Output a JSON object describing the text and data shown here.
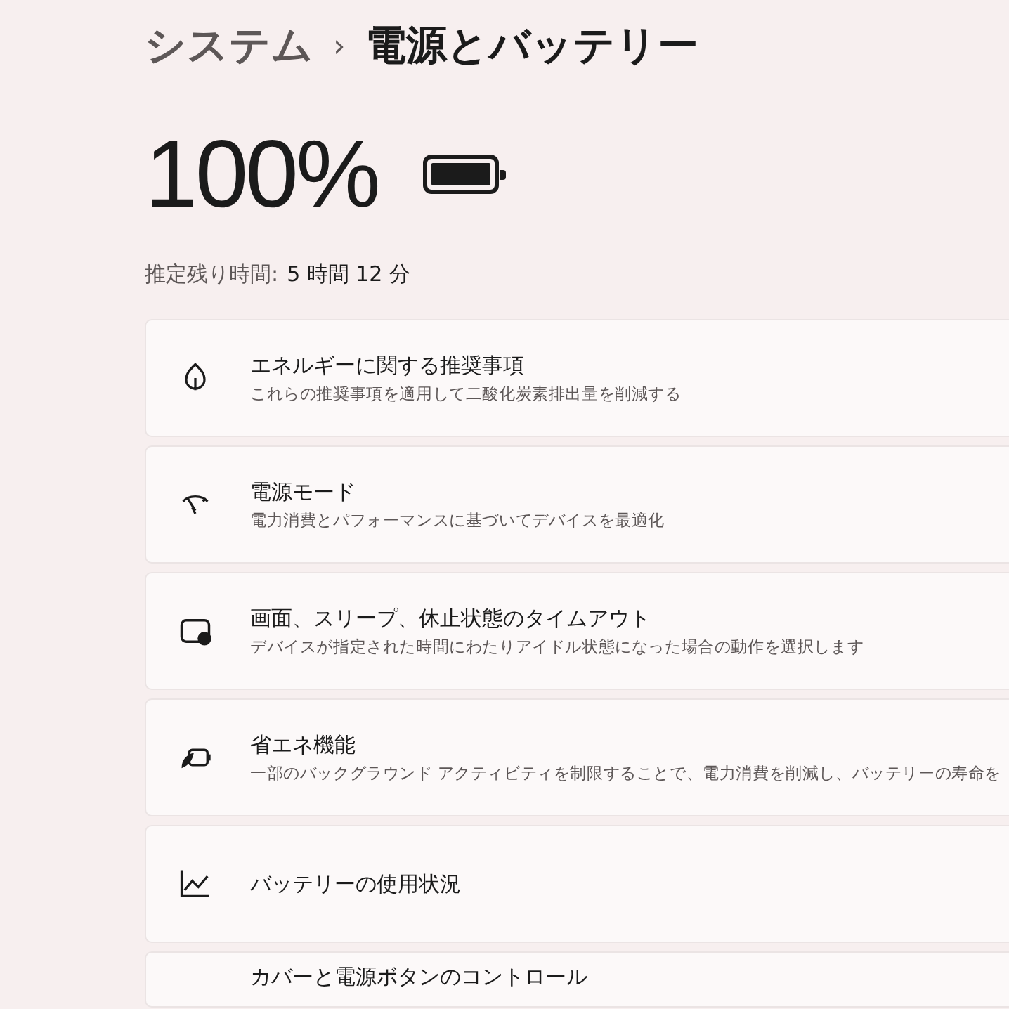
{
  "breadcrumb": {
    "parent": "システム",
    "separator": "›",
    "current": "電源とバッテリー"
  },
  "battery": {
    "percent": "100%",
    "level": 1.0,
    "remaining_label": "推定残り時間:",
    "remaining_value": "5 時間 12 分"
  },
  "settings": [
    {
      "title": "エネルギーに関する推奨事項",
      "description": "これらの推奨事項を適用して二酸化炭素排出量を削減する"
    },
    {
      "title": "電源モード",
      "description": "電力消費とパフォーマンスに基づいてデバイスを最適化"
    },
    {
      "title": "画面、スリープ、休止状態のタイムアウト",
      "description": "デバイスが指定された時間にわたりアイドル状態になった場合の動作を選択します"
    },
    {
      "title": "省エネ機能",
      "description": "一部のバックグラウンド アクティビティを制限することで、電力消費を削減し、バッテリーの寿命を"
    },
    {
      "title": "バッテリーの使用状況"
    },
    {
      "title": "カバーと電源ボタンのコントロール"
    }
  ]
}
